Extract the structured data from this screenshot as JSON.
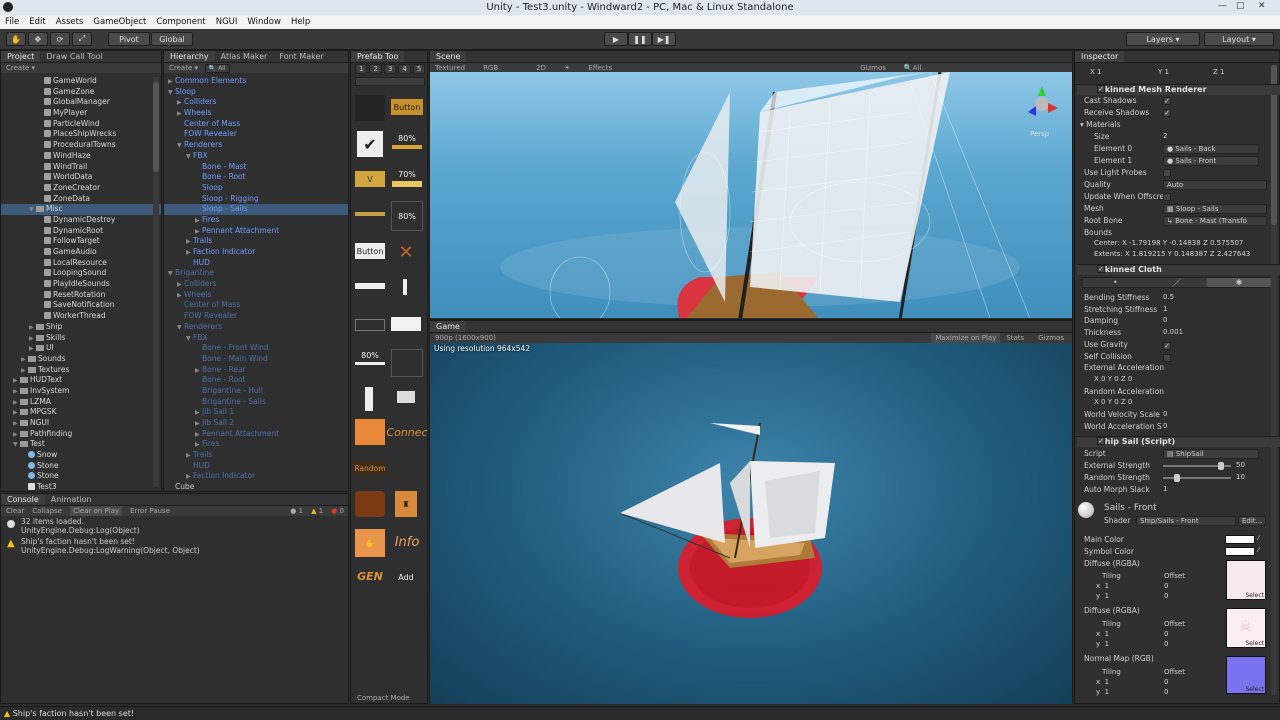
{
  "window": {
    "title": "Unity - Test3.unity - Windward2 - PC, Mac & Linux Standalone"
  },
  "menu": [
    "File",
    "Edit",
    "Assets",
    "GameObject",
    "Component",
    "NGUI",
    "Window",
    "Help"
  ],
  "toolbar": {
    "pivot": "Pivot",
    "global": "Global",
    "layers": "Layers",
    "layout": "Layout"
  },
  "project": {
    "tabs": [
      "Project",
      "Draw Call Tool"
    ],
    "create": "Create",
    "items": [
      {
        "label": "GameWorld",
        "indent": 4,
        "icon": "script"
      },
      {
        "label": "GameZone",
        "indent": 4,
        "icon": "script"
      },
      {
        "label": "GlobalManager",
        "indent": 4,
        "icon": "script"
      },
      {
        "label": "MyPlayer",
        "indent": 4,
        "icon": "script"
      },
      {
        "label": "ParticleWind",
        "indent": 4,
        "icon": "script"
      },
      {
        "label": "PlaceShipWrecks",
        "indent": 4,
        "icon": "script"
      },
      {
        "label": "ProceduralTowns",
        "indent": 4,
        "icon": "script"
      },
      {
        "label": "WindHaze",
        "indent": 4,
        "icon": "script"
      },
      {
        "label": "WindTrail",
        "indent": 4,
        "icon": "script"
      },
      {
        "label": "WorldData",
        "indent": 4,
        "icon": "script"
      },
      {
        "label": "ZoneCreator",
        "indent": 4,
        "icon": "script"
      },
      {
        "label": "ZoneData",
        "indent": 4,
        "icon": "script"
      },
      {
        "label": "Misc",
        "indent": 3,
        "icon": "folder",
        "sel": true,
        "arrow": "▼"
      },
      {
        "label": "DynamicDestroy",
        "indent": 4,
        "icon": "script"
      },
      {
        "label": "DynamicRoot",
        "indent": 4,
        "icon": "script"
      },
      {
        "label": "FollowTarget",
        "indent": 4,
        "icon": "script"
      },
      {
        "label": "GameAudio",
        "indent": 4,
        "icon": "script"
      },
      {
        "label": "LocalResource",
        "indent": 4,
        "icon": "script"
      },
      {
        "label": "LoopingSound",
        "indent": 4,
        "icon": "script"
      },
      {
        "label": "PlayIdleSounds",
        "indent": 4,
        "icon": "script"
      },
      {
        "label": "ResetRotation",
        "indent": 4,
        "icon": "script"
      },
      {
        "label": "SaveNotification",
        "indent": 4,
        "icon": "script"
      },
      {
        "label": "WorkerThread",
        "indent": 4,
        "icon": "script"
      },
      {
        "label": "Ship",
        "indent": 3,
        "icon": "folder",
        "arrow": "▶"
      },
      {
        "label": "Skills",
        "indent": 3,
        "icon": "folder",
        "arrow": "▶"
      },
      {
        "label": "UI",
        "indent": 3,
        "icon": "folder",
        "arrow": "▶"
      },
      {
        "label": "Sounds",
        "indent": 2,
        "icon": "folder",
        "arrow": "▶"
      },
      {
        "label": "Textures",
        "indent": 2,
        "icon": "folder",
        "arrow": "▶"
      },
      {
        "label": "HUDText",
        "indent": 1,
        "icon": "folder",
        "arrow": "▶"
      },
      {
        "label": "InvSystem",
        "indent": 1,
        "icon": "folder",
        "arrow": "▶"
      },
      {
        "label": "LZMA",
        "indent": 1,
        "icon": "folder",
        "arrow": "▶"
      },
      {
        "label": "MPGSK",
        "indent": 1,
        "icon": "folder",
        "arrow": "▶"
      },
      {
        "label": "NGUI",
        "indent": 1,
        "icon": "folder",
        "arrow": "▶"
      },
      {
        "label": "Pathfinding",
        "indent": 1,
        "icon": "folder",
        "arrow": "▶"
      },
      {
        "label": "Test",
        "indent": 1,
        "icon": "folder",
        "arrow": "▼"
      },
      {
        "label": "Snow",
        "indent": 2,
        "icon": "sphere"
      },
      {
        "label": "Stone",
        "indent": 2,
        "icon": "sphere"
      },
      {
        "label": "Stone",
        "indent": 2,
        "icon": "sphere"
      },
      {
        "label": "Test3",
        "indent": 2,
        "icon": "unity"
      }
    ]
  },
  "hierarchy": {
    "tabs": [
      "Hierarchy",
      "Atlas Maker",
      "Font Maker"
    ],
    "create": "Create",
    "search": "All",
    "items": [
      {
        "label": "Common Elements",
        "indent": 0,
        "style": "blue",
        "arrow": "▶"
      },
      {
        "label": "Sloop",
        "indent": 0,
        "style": "blue",
        "arrow": "▼"
      },
      {
        "label": "Colliders",
        "indent": 1,
        "style": "blue",
        "arrow": "▶"
      },
      {
        "label": "Wheels",
        "indent": 1,
        "style": "blue",
        "arrow": "▶"
      },
      {
        "label": "Center of Mass",
        "indent": 1,
        "style": "blue"
      },
      {
        "label": "FOW Revealer",
        "indent": 1,
        "style": "blue"
      },
      {
        "label": "Renderers",
        "indent": 1,
        "style": "blue",
        "arrow": "▼"
      },
      {
        "label": "FBX",
        "indent": 2,
        "style": "blue",
        "arrow": "▼"
      },
      {
        "label": "Bone - Mast",
        "indent": 3,
        "style": "blue"
      },
      {
        "label": "Bone - Root",
        "indent": 3,
        "style": "blue"
      },
      {
        "label": "Sloop",
        "indent": 3,
        "style": "blue"
      },
      {
        "label": "Sloop - Rigging",
        "indent": 3,
        "style": "blue"
      },
      {
        "label": "Sloop - Sails",
        "indent": 3,
        "style": "blue",
        "sel": true
      },
      {
        "label": "Fires",
        "indent": 3,
        "style": "blue",
        "arrow": "▶"
      },
      {
        "label": "Pennant Attachment",
        "indent": 3,
        "style": "blue",
        "arrow": "▶"
      },
      {
        "label": "Trails",
        "indent": 2,
        "style": "blue",
        "arrow": "▶"
      },
      {
        "label": "Faction Indicator",
        "indent": 2,
        "style": "blue",
        "arrow": "▶"
      },
      {
        "label": "HUD",
        "indent": 2,
        "style": "blue"
      },
      {
        "label": "Brigantine",
        "indent": 0,
        "style": "dim",
        "arrow": "▼"
      },
      {
        "label": "Colliders",
        "indent": 1,
        "style": "dim",
        "arrow": "▶"
      },
      {
        "label": "Wheels",
        "indent": 1,
        "style": "dim",
        "arrow": "▶"
      },
      {
        "label": "Center of Mass",
        "indent": 1,
        "style": "dim"
      },
      {
        "label": "FOW Revealer",
        "indent": 1,
        "style": "dim"
      },
      {
        "label": "Renderers",
        "indent": 1,
        "style": "dim",
        "arrow": "▼"
      },
      {
        "label": "FBX",
        "indent": 2,
        "style": "dim",
        "arrow": "▼"
      },
      {
        "label": "Bone - Front Wind",
        "indent": 3,
        "style": "dim"
      },
      {
        "label": "Bone - Main Wind",
        "indent": 3,
        "style": "dim"
      },
      {
        "label": "Bone - Rear",
        "indent": 3,
        "style": "dim",
        "arrow": "▶"
      },
      {
        "label": "Bone - Root",
        "indent": 3,
        "style": "dim"
      },
      {
        "label": "Brigantine - Hull",
        "indent": 3,
        "style": "dim"
      },
      {
        "label": "Brigantine - Sails",
        "indent": 3,
        "style": "dim"
      },
      {
        "label": "Jib Sail 1",
        "indent": 3,
        "style": "dim",
        "arrow": "▶"
      },
      {
        "label": "Jib Sail 2",
        "indent": 3,
        "style": "dim",
        "arrow": "▶"
      },
      {
        "label": "Pennant Attachment",
        "indent": 3,
        "style": "dim",
        "arrow": "▶"
      },
      {
        "label": "Fires",
        "indent": 3,
        "style": "dim",
        "arrow": "▶"
      },
      {
        "label": "Trails",
        "indent": 2,
        "style": "dim",
        "arrow": "▶"
      },
      {
        "label": "HUD",
        "indent": 2,
        "style": "dim"
      },
      {
        "label": "Faction Indicator",
        "indent": 2,
        "style": "dim",
        "arrow": "▶"
      },
      {
        "label": "Cube",
        "indent": 0,
        "style": "plain"
      }
    ]
  },
  "prefab": {
    "tab": "Prefab Too",
    "pages": [
      "1",
      "2",
      "3",
      "4",
      "5"
    ],
    "items": {
      "button": "Button",
      "pct80": "80%",
      "pct70": "70%",
      "v": "V",
      "pct80b": "80%",
      "button2": "Button",
      "pct80c": "80%",
      "connect": "Connec",
      "random": "Random",
      "info": "Info",
      "gen": "GEN",
      "add": "Add"
    },
    "compact": "Compact Mode"
  },
  "scene": {
    "tab": "Scene",
    "shading": "Textured",
    "rgb": "RGB",
    "twod": "2D",
    "effects": "Effects",
    "gizmos": "Gizmos",
    "search": "All",
    "persp": "Persp"
  },
  "game": {
    "tab": "Game",
    "resolution": "900p (1600x900)",
    "maximize": "Maximize on Play",
    "stats": "Stats",
    "gizmos": "Gizmos",
    "overlay": "Using resolution 964x542"
  },
  "console": {
    "tabs": [
      "Console",
      "Animation"
    ],
    "buttons": [
      "Clear",
      "Collapse",
      "Clear on Play",
      "Error Pause"
    ],
    "counts": {
      "info": "1",
      "warn": "1",
      "err": "0"
    },
    "messages": [
      {
        "line1": "32 items loaded.",
        "line2": "UnityEngine.Debug:Log(Object)",
        "type": "info"
      },
      {
        "line1": "Ship's faction hasn't been set!",
        "line2": "UnityEngine.Debug:LogWarning(Object, Object)",
        "type": "warn"
      }
    ]
  },
  "status": {
    "text": "Ship's faction hasn't been set!"
  },
  "inspector": {
    "tab": "Inspector",
    "scale": {
      "x": "1",
      "y": "1",
      "z": "1",
      "lx": "X",
      "ly": "Y",
      "lz": "Z"
    },
    "smr": {
      "title": "Skinned Mesh Renderer",
      "cast": "Cast Shadows",
      "receive": "Receive Shadows",
      "materials": "Materials",
      "size": "Size",
      "size_val": "2",
      "el0": "Element 0",
      "el0_val": "Sails - Back",
      "el1": "Element 1",
      "el1_val": "Sails - Front",
      "probes": "Use Light Probes",
      "quality": "Quality",
      "quality_val": "Auto",
      "offscreen": "Update When Offscre",
      "mesh": "Mesh",
      "mesh_val": "Sloop - Sails",
      "root": "Root Bone",
      "root_val": "Bone - Mast (Transfo",
      "bounds": "Bounds",
      "center": "Center: X -1.79198  Y -0.14838  Z 0.575507",
      "extents": "Extents: X 1.819215  Y 0.148387  Z 2.427643"
    },
    "cloth": {
      "title": "Skinned Cloth",
      "rows": [
        {
          "label": "Bending Stiffness",
          "val": "0.5"
        },
        {
          "label": "Stretching Stiffness",
          "val": "1"
        },
        {
          "label": "Damping",
          "val": "0"
        },
        {
          "label": "Thickness",
          "val": "0.001"
        },
        {
          "label": "Use Gravity",
          "val": ""
        },
        {
          "label": "Self Collision",
          "val": ""
        },
        {
          "label": "External Acceleration",
          "val": ""
        },
        {
          "label": "",
          "val": "X 0    Y 0    Z 0"
        },
        {
          "label": "Random Acceleration",
          "val": ""
        },
        {
          "label": "",
          "val": "X 0    Y 0    Z 0"
        },
        {
          "label": "World Velocity Scale",
          "val": "0"
        },
        {
          "label": "World Acceleration S",
          "val": "0"
        }
      ]
    },
    "shipsail": {
      "title": "Ship Sail (Script)",
      "script": "Script",
      "script_val": "ShipSail",
      "ext": "External Strength",
      "ext_val": "50",
      "ext_level": 0.88,
      "rand": "Random Strength",
      "rand_val": "10",
      "rand_level": 0.18,
      "morph": "Auto Morph Slack",
      "morph_val": "1"
    },
    "material": {
      "name": "Sails - Front",
      "shader_label": "Shader",
      "shader": "Ship/Sails - Front",
      "edit": "Edit...",
      "main": "Main Color",
      "symbol": "Symbol Color",
      "diffuse1": "Diffuse (RGBA)",
      "diffuse2": "Diffuse (RGBA)",
      "normal": "Normal Map (RGB)",
      "tiling": "Tiling",
      "offset": "Offset",
      "x": "x",
      "y": "y",
      "one": "1",
      "zero": "0",
      "select": "Select"
    },
    "colors": {
      "main": "#ffffff",
      "symbol": "#ffffff",
      "tex1": "#f7eaea",
      "tex2": "#fbeeee",
      "tex3": "#7b72f0"
    }
  }
}
